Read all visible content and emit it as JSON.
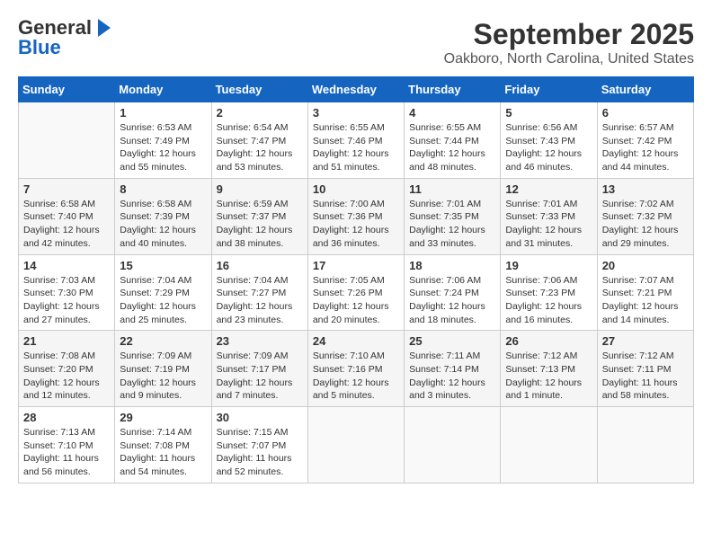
{
  "header": {
    "logo_general": "General",
    "logo_blue": "Blue",
    "month": "September 2025",
    "location": "Oakboro, North Carolina, United States"
  },
  "columns": [
    "Sunday",
    "Monday",
    "Tuesday",
    "Wednesday",
    "Thursday",
    "Friday",
    "Saturday"
  ],
  "weeks": [
    [
      {
        "day": "",
        "info": ""
      },
      {
        "day": "1",
        "info": "Sunrise: 6:53 AM\nSunset: 7:49 PM\nDaylight: 12 hours\nand 55 minutes."
      },
      {
        "day": "2",
        "info": "Sunrise: 6:54 AM\nSunset: 7:47 PM\nDaylight: 12 hours\nand 53 minutes."
      },
      {
        "day": "3",
        "info": "Sunrise: 6:55 AM\nSunset: 7:46 PM\nDaylight: 12 hours\nand 51 minutes."
      },
      {
        "day": "4",
        "info": "Sunrise: 6:55 AM\nSunset: 7:44 PM\nDaylight: 12 hours\nand 48 minutes."
      },
      {
        "day": "5",
        "info": "Sunrise: 6:56 AM\nSunset: 7:43 PM\nDaylight: 12 hours\nand 46 minutes."
      },
      {
        "day": "6",
        "info": "Sunrise: 6:57 AM\nSunset: 7:42 PM\nDaylight: 12 hours\nand 44 minutes."
      }
    ],
    [
      {
        "day": "7",
        "info": "Sunrise: 6:58 AM\nSunset: 7:40 PM\nDaylight: 12 hours\nand 42 minutes."
      },
      {
        "day": "8",
        "info": "Sunrise: 6:58 AM\nSunset: 7:39 PM\nDaylight: 12 hours\nand 40 minutes."
      },
      {
        "day": "9",
        "info": "Sunrise: 6:59 AM\nSunset: 7:37 PM\nDaylight: 12 hours\nand 38 minutes."
      },
      {
        "day": "10",
        "info": "Sunrise: 7:00 AM\nSunset: 7:36 PM\nDaylight: 12 hours\nand 36 minutes."
      },
      {
        "day": "11",
        "info": "Sunrise: 7:01 AM\nSunset: 7:35 PM\nDaylight: 12 hours\nand 33 minutes."
      },
      {
        "day": "12",
        "info": "Sunrise: 7:01 AM\nSunset: 7:33 PM\nDaylight: 12 hours\nand 31 minutes."
      },
      {
        "day": "13",
        "info": "Sunrise: 7:02 AM\nSunset: 7:32 PM\nDaylight: 12 hours\nand 29 minutes."
      }
    ],
    [
      {
        "day": "14",
        "info": "Sunrise: 7:03 AM\nSunset: 7:30 PM\nDaylight: 12 hours\nand 27 minutes."
      },
      {
        "day": "15",
        "info": "Sunrise: 7:04 AM\nSunset: 7:29 PM\nDaylight: 12 hours\nand 25 minutes."
      },
      {
        "day": "16",
        "info": "Sunrise: 7:04 AM\nSunset: 7:27 PM\nDaylight: 12 hours\nand 23 minutes."
      },
      {
        "day": "17",
        "info": "Sunrise: 7:05 AM\nSunset: 7:26 PM\nDaylight: 12 hours\nand 20 minutes."
      },
      {
        "day": "18",
        "info": "Sunrise: 7:06 AM\nSunset: 7:24 PM\nDaylight: 12 hours\nand 18 minutes."
      },
      {
        "day": "19",
        "info": "Sunrise: 7:06 AM\nSunset: 7:23 PM\nDaylight: 12 hours\nand 16 minutes."
      },
      {
        "day": "20",
        "info": "Sunrise: 7:07 AM\nSunset: 7:21 PM\nDaylight: 12 hours\nand 14 minutes."
      }
    ],
    [
      {
        "day": "21",
        "info": "Sunrise: 7:08 AM\nSunset: 7:20 PM\nDaylight: 12 hours\nand 12 minutes."
      },
      {
        "day": "22",
        "info": "Sunrise: 7:09 AM\nSunset: 7:19 PM\nDaylight: 12 hours\nand 9 minutes."
      },
      {
        "day": "23",
        "info": "Sunrise: 7:09 AM\nSunset: 7:17 PM\nDaylight: 12 hours\nand 7 minutes."
      },
      {
        "day": "24",
        "info": "Sunrise: 7:10 AM\nSunset: 7:16 PM\nDaylight: 12 hours\nand 5 minutes."
      },
      {
        "day": "25",
        "info": "Sunrise: 7:11 AM\nSunset: 7:14 PM\nDaylight: 12 hours\nand 3 minutes."
      },
      {
        "day": "26",
        "info": "Sunrise: 7:12 AM\nSunset: 7:13 PM\nDaylight: 12 hours\nand 1 minute."
      },
      {
        "day": "27",
        "info": "Sunrise: 7:12 AM\nSunset: 7:11 PM\nDaylight: 11 hours\nand 58 minutes."
      }
    ],
    [
      {
        "day": "28",
        "info": "Sunrise: 7:13 AM\nSunset: 7:10 PM\nDaylight: 11 hours\nand 56 minutes."
      },
      {
        "day": "29",
        "info": "Sunrise: 7:14 AM\nSunset: 7:08 PM\nDaylight: 11 hours\nand 54 minutes."
      },
      {
        "day": "30",
        "info": "Sunrise: 7:15 AM\nSunset: 7:07 PM\nDaylight: 11 hours\nand 52 minutes."
      },
      {
        "day": "",
        "info": ""
      },
      {
        "day": "",
        "info": ""
      },
      {
        "day": "",
        "info": ""
      },
      {
        "day": "",
        "info": ""
      }
    ]
  ]
}
